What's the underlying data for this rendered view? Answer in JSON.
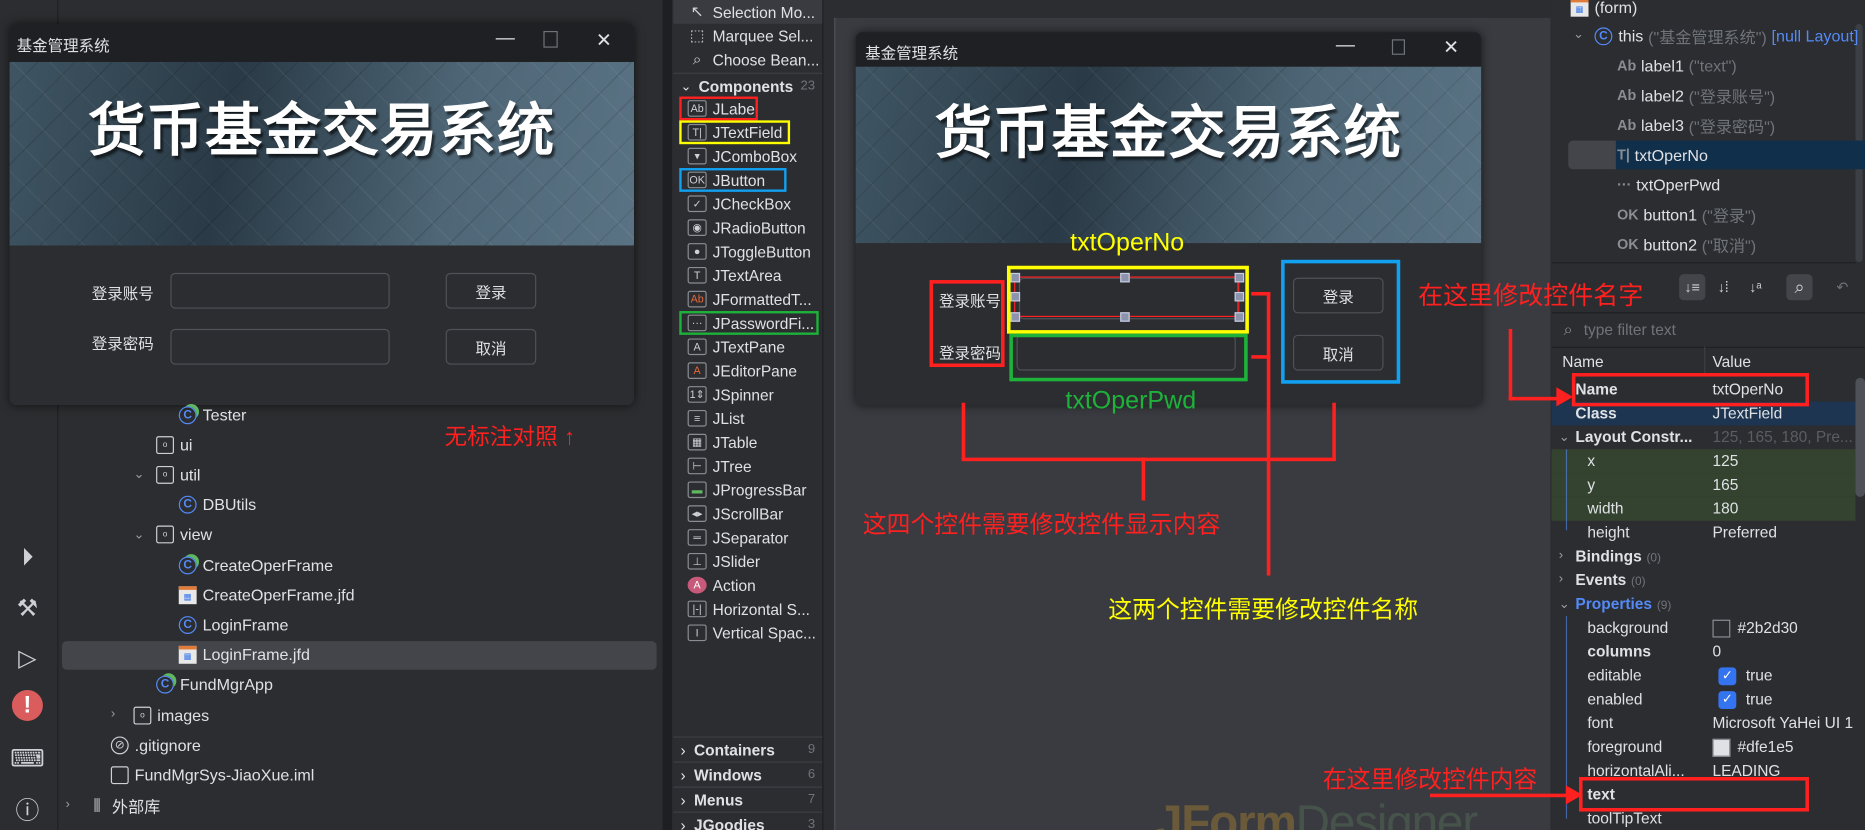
{
  "project_tree": {
    "items": [
      {
        "label": "Tester",
        "icon": "class-run-icon",
        "depth": 4
      },
      {
        "label": "ui",
        "icon": "folder-icon",
        "depth": 3
      },
      {
        "label": "util",
        "icon": "folder-icon",
        "depth": 3,
        "expanded": true
      },
      {
        "label": "DBUtils",
        "icon": "class-icon",
        "depth": 4
      },
      {
        "label": "view",
        "icon": "folder-icon",
        "depth": 3,
        "expanded": true
      },
      {
        "label": "CreateOperFrame",
        "icon": "class-run-icon",
        "depth": 4
      },
      {
        "label": "CreateOperFrame.jfd",
        "icon": "jfd-icon",
        "depth": 4
      },
      {
        "label": "LoginFrame",
        "icon": "class-icon",
        "depth": 4
      },
      {
        "label": "LoginFrame.jfd",
        "icon": "jfd-icon",
        "depth": 4,
        "selected": true
      },
      {
        "label": "FundMgrApp",
        "icon": "class-run-icon",
        "depth": 3
      },
      {
        "label": "images",
        "icon": "folder-icon",
        "depth": 2,
        "expanded": false
      },
      {
        "label": ".gitignore",
        "icon": "gitignore-icon",
        "depth": 1
      },
      {
        "label": "FundMgrSys-JiaoXue.iml",
        "icon": "iml-file-icon",
        "depth": 1
      },
      {
        "label": "外部库",
        "icon": "library-icon",
        "depth": 0,
        "expanded": false
      }
    ]
  },
  "left_toolbar": [
    "services-icon",
    "build-hammer-icon",
    "run-icon",
    "problems-icon",
    "terminal-icon"
  ],
  "preview_window": {
    "title": "基金管理系统",
    "banner_text": "货币基金交易系统",
    "label_account": "登录账号",
    "label_password": "登录密码",
    "login_button": "登录",
    "cancel_button": "取消"
  },
  "preview_note": "无标注对照 ↑",
  "palette": {
    "tools": [
      {
        "label": "Selection Mo...",
        "icon": "cursor-icon"
      },
      {
        "label": "Marquee Sel...",
        "icon": "marquee-icon"
      },
      {
        "label": "Choose Bean...",
        "icon": "choose-bean-icon"
      }
    ],
    "components_header": "Components",
    "components_count": "23",
    "components": [
      {
        "label": "JLabel",
        "icon": "Ab"
      },
      {
        "label": "JTextField",
        "icon": "T|"
      },
      {
        "label": "JComboBox",
        "icon": "▾"
      },
      {
        "label": "JButton",
        "icon": "OK"
      },
      {
        "label": "JCheckBox",
        "icon": "✓"
      },
      {
        "label": "JRadioButton",
        "icon": "◉"
      },
      {
        "label": "JToggleButton",
        "icon": "●"
      },
      {
        "label": "JTextArea",
        "icon": "T"
      },
      {
        "label": "JFormattedT...",
        "icon": "Ab"
      },
      {
        "label": "JPasswordFi...",
        "icon": "···"
      },
      {
        "label": "JTextPane",
        "icon": "A"
      },
      {
        "label": "JEditorPane",
        "icon": "A"
      },
      {
        "label": "JSpinner",
        "icon": "1⇕"
      },
      {
        "label": "JList",
        "icon": "≡"
      },
      {
        "label": "JTable",
        "icon": "▦"
      },
      {
        "label": "JTree",
        "icon": "⊢"
      },
      {
        "label": "JProgressBar",
        "icon": "▬"
      },
      {
        "label": "JScrollBar",
        "icon": "◂▸"
      },
      {
        "label": "JSeparator",
        "icon": "═"
      },
      {
        "label": "JSlider",
        "icon": "⊥"
      },
      {
        "label": "Action",
        "icon": "A"
      },
      {
        "label": "Horizontal S...",
        "icon": "|-|"
      },
      {
        "label": "Vertical Spac...",
        "icon": "I"
      }
    ],
    "groups": [
      {
        "label": "Containers",
        "count": "9"
      },
      {
        "label": "Windows",
        "count": "6"
      },
      {
        "label": "Menus",
        "count": "7"
      },
      {
        "label": "JGoodies",
        "count": "3"
      }
    ]
  },
  "designer_form": {
    "title": "基金管理系统",
    "banner_text": "货币基金交易系统",
    "label_account": "登录账号",
    "label_password": "登录密码",
    "login_button": "登录",
    "cancel_button": "取消"
  },
  "watermark": "JFormDesigner™",
  "annotations": {
    "txtOperNo": "txtOperNo",
    "txtOperPwd": "txtOperPwd",
    "four_controls": "这四个控件需要修改控件显示内容",
    "two_controls": "这两个控件需要修改控件名称",
    "modify_name": "在这里修改控件名字",
    "modify_content": "在这里修改控件内容",
    "colors": {
      "red": "#ff2020",
      "yellow": "#ffff00",
      "green": "#1db33a",
      "blue": "#12a0f0"
    }
  },
  "component_tree": {
    "form": "(form)",
    "root": {
      "name": "this",
      "detail": "(\"基金管理系统\")",
      "layout": "[null Layout]"
    },
    "children": [
      {
        "icon": "Ab",
        "name": "label1",
        "detail": "(\"text\")"
      },
      {
        "icon": "Ab",
        "name": "label2",
        "detail": "(\"登录账号\")"
      },
      {
        "icon": "Ab",
        "name": "label3",
        "detail": "(\"登录密码\")"
      },
      {
        "icon": "T|",
        "name": "txtOperNo",
        "detail": "",
        "selected": true
      },
      {
        "icon": "···",
        "name": "txtOperPwd",
        "detail": ""
      },
      {
        "icon": "OK",
        "name": "button1",
        "detail": "(\"登录\")"
      },
      {
        "icon": "OK",
        "name": "button2",
        "detail": "(\"取消\")"
      }
    ]
  },
  "properties": {
    "filter_placeholder": "type filter text",
    "col_name": "Name",
    "col_value": "Value",
    "rows": [
      {
        "name": "Name",
        "value": "txtOperNo",
        "bold": true
      },
      {
        "name": "Class",
        "value": "JTextField",
        "bold": true,
        "highlight": "blue"
      },
      {
        "name": "Layout Constr...",
        "value": "125, 165, 180, Pre...",
        "bold": true,
        "group": true,
        "dimValue": true
      },
      {
        "name": "x",
        "value": "125",
        "indent": true,
        "highlight": "green"
      },
      {
        "name": "y",
        "value": "165",
        "indent": true,
        "highlight": "green"
      },
      {
        "name": "width",
        "value": "180",
        "indent": true,
        "highlight": "green"
      },
      {
        "name": "height",
        "value": "Preferred",
        "indent": true
      },
      {
        "name": "Bindings",
        "count": "(0)",
        "bold": true,
        "collapsed": true
      },
      {
        "name": "Events",
        "count": "(0)",
        "bold": true,
        "collapsed": true
      },
      {
        "name": "Properties",
        "count": "(9)",
        "bold": true,
        "group": true,
        "accent": true
      },
      {
        "name": "background",
        "value": "#2b2d30",
        "indent": true,
        "swatch": "#2b2d30"
      },
      {
        "name": "columns",
        "value": "0",
        "indent": true,
        "bold": true
      },
      {
        "name": "editable",
        "value": "true",
        "indent": true,
        "checkbox": true
      },
      {
        "name": "enabled",
        "value": "true",
        "indent": true,
        "checkbox": true
      },
      {
        "name": "font",
        "value": "Microsoft YaHei UI 1",
        "indent": true
      },
      {
        "name": "foreground",
        "value": "#dfe1e5",
        "indent": true,
        "swatch": "#dfe1e5"
      },
      {
        "name": "horizontalAli...",
        "value": "LEADING",
        "indent": true
      },
      {
        "name": "text",
        "value": "",
        "indent": true,
        "bold": true
      },
      {
        "name": "toolTipText",
        "value": "",
        "indent": true
      }
    ]
  }
}
